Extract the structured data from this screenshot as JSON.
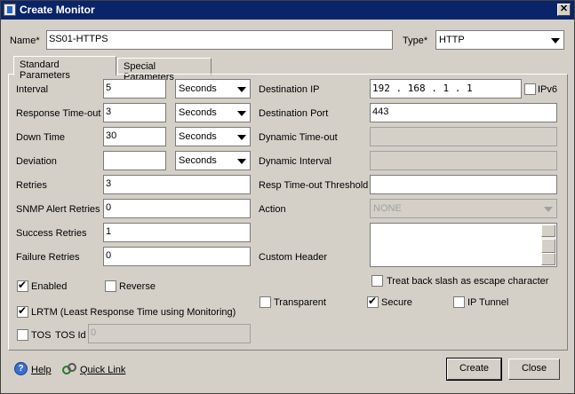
{
  "window": {
    "title": "Create Monitor"
  },
  "form": {
    "name_label": "Name*",
    "name_value": "SS01-HTTPS",
    "type_label": "Type*",
    "type_value": "HTTP"
  },
  "tabs": [
    {
      "label": "Standard Parameters"
    },
    {
      "label": "Special Parameters"
    }
  ],
  "left": {
    "interval": {
      "label": "Interval",
      "value": "5",
      "unit": "Seconds"
    },
    "response_timeout": {
      "label": "Response Time-out",
      "value": "3",
      "unit": "Seconds"
    },
    "down_time": {
      "label": "Down Time",
      "value": "30",
      "unit": "Seconds"
    },
    "deviation": {
      "label": "Deviation",
      "value": "",
      "unit": "Seconds"
    },
    "retries": {
      "label": "Retries",
      "value": "3"
    },
    "snmp_alert_retries": {
      "label": "SNMP Alert Retries",
      "value": "0"
    },
    "success_retries": {
      "label": "Success Retries",
      "value": "1"
    },
    "failure_retries": {
      "label": "Failure Retries",
      "value": "0"
    }
  },
  "right": {
    "destination_ip": {
      "label": "Destination IP",
      "value": "192 . 168 . 1   . 1"
    },
    "ipv6": {
      "label": "IPv6",
      "checked": false
    },
    "destination_port": {
      "label": "Destination Port",
      "value": "443"
    },
    "dynamic_timeout": {
      "label": "Dynamic Time-out",
      "value": ""
    },
    "dynamic_interval": {
      "label": "Dynamic Interval",
      "value": ""
    },
    "resp_timeout_threshold": {
      "label": "Resp Time-out Threshold",
      "value": ""
    },
    "action": {
      "label": "Action",
      "value": "NONE"
    },
    "custom_header": {
      "label": "Custom Header",
      "value": ""
    },
    "treat_backslash": {
      "label": "Treat back slash as escape character",
      "checked": false
    }
  },
  "checks": {
    "enabled": {
      "label": "Enabled",
      "checked": true
    },
    "reverse": {
      "label": "Reverse",
      "checked": false
    },
    "lrtm": {
      "label": "LRTM (Least Response Time using Monitoring)",
      "checked": true
    },
    "tos": {
      "label": "TOS",
      "checked": false
    },
    "tos_id_label": "TOS Id",
    "tos_id_value": "0",
    "transparent": {
      "label": "Transparent",
      "checked": false
    },
    "secure": {
      "label": "Secure",
      "checked": true
    },
    "ip_tunnel": {
      "label": "IP Tunnel",
      "checked": false
    }
  },
  "footer": {
    "help": "Help",
    "quick_link": "Quick Link",
    "create": "Create",
    "close": "Close"
  }
}
